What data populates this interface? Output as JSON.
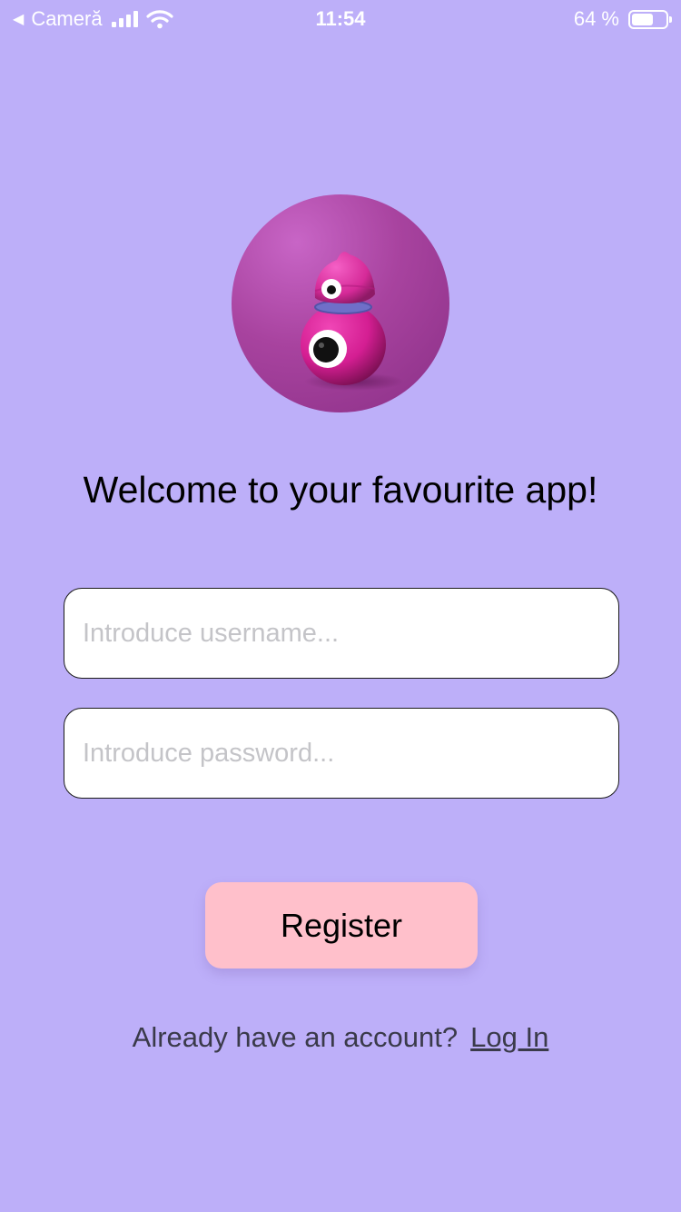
{
  "status_bar": {
    "carrier": "Cameră",
    "time": "11:54",
    "battery_percent": "64 %",
    "battery_level": 0.64,
    "back_icon": "back-triangle-icon",
    "signal_icon": "cellular-signal-icon",
    "wifi_icon": "wifi-icon",
    "battery_icon": "battery-icon"
  },
  "avatar": {
    "icon": "pink-robot-mascot-image"
  },
  "title": "Welcome to your favourite app!",
  "form": {
    "username_placeholder": "Introduce username...",
    "username_value": "",
    "password_placeholder": "Introduce password...",
    "password_value": ""
  },
  "register_label": "Register",
  "footer": {
    "prompt": "Already have an account?",
    "login_label": "Log In"
  },
  "colors": {
    "background": "#BDAFF9",
    "button": "#FFC0CB",
    "avatar": "#A8439F"
  }
}
